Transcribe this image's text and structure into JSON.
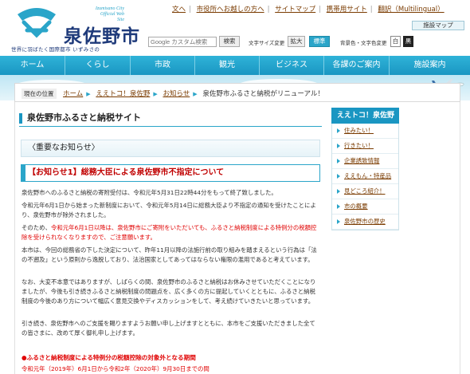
{
  "header": {
    "logo_en_line1": "Izumisano City",
    "logo_en_line2": "Official Web Site",
    "logo_ja": "泉佐野市",
    "slogan": "世界に羽ばたく国際都市 いずみさの"
  },
  "toplinks": [
    "文へ",
    "市役所へお越しの方へ",
    "サイトマップ",
    "携帯用サイト",
    "翻訳（Multilingual）"
  ],
  "facility_map_button": "施設マップ",
  "search": {
    "placeholder": "Google カスタム検索",
    "button": "検索"
  },
  "font_size": {
    "label": "文字サイズ変更",
    "large": "拡大",
    "standard": "標準"
  },
  "color_change": {
    "label": "背景色・文字色変更",
    "white": "白",
    "black": "黒"
  },
  "gnav": [
    "ホーム",
    "くらし",
    "市政",
    "観光",
    "ビジネス",
    "各課のご案内",
    "施設案内"
  ],
  "breadcrumb": {
    "label": "現在の位置",
    "items": [
      "ホーム",
      "ええトコ！泉佐野",
      "お知らせ"
    ],
    "current": "泉佐野市ふるさと納税がリニューアル！"
  },
  "main": {
    "title": "泉佐野市ふるさと納税サイト",
    "notice_heading": "〈重要なお知らせ〉",
    "red_heading": "【お知らせ1】総務大臣による泉佐野市不指定について",
    "para1": "泉佐野市へのふるさと納税の寄附受付は、令和元年5月31日22時44分をもって終了致しました。",
    "para2": "令和元年6月1日から始まった新制度において、令和元年5月14日に総務大臣より不指定の通知を受けたことにより、泉佐野市が除外されました。",
    "para3_black1": "そのため、",
    "para3_red": "令和元年6月1日以降は、泉佐野市にご寄附をいただいても、ふるさと納税制度による特例分の税額控除を受けられなくなりますので、ご注意願います。",
    "para4": "本市は、今回の総務省の下した決定について、昨年11月以降の法施行前の取り組みを踏まえるという行為は「法の不遡及」という原則から逸脱しており、法治国家としてあってはならない権限の濫用であると考えています。",
    "para5": "なお、大変不本意ではありますが、しばらくの間、泉佐野市のふるさと納税はお休みさせていただくことになりましたが、今後も引き続きふるさと納税制度の問題点を、広く多くの方に提起していくとともに、ふるさと納税制度の今後のあり方について幅広く意見交換やディスカッションをして、考え続けていきたいと思っています。",
    "para6": "引き続き、泉佐野市へのご支援を賜りますようお願い申し上げますとともに、本市をご支援いただきました全ての皆さまに、改めて厚く御礼申し上げます。",
    "bullet_head": "●ふるさと納税制度による特例分の税額控除の対象外となる期間",
    "bullet_sub": "令和元年（2019年）6月1日から令和2年（2020年）9月30日までの間"
  },
  "sidebar": {
    "title": "ええトコ！泉佐野",
    "items": [
      "住みたい！",
      "行きたい！",
      "企業誘致情報",
      "ええもん・特産品",
      "見どころ紹介！",
      "市の概要",
      "泉佐野市の歴史"
    ]
  }
}
